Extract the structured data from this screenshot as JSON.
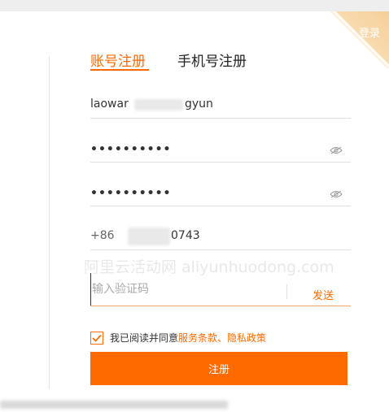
{
  "corner": {
    "login_label": "登录"
  },
  "tabs": [
    {
      "label": "账号注册",
      "active": true
    },
    {
      "label": "手机号注册",
      "active": false
    }
  ],
  "form": {
    "username_left": "laowar",
    "username_right": "gyun",
    "password": "••••••••••",
    "password_confirm": "••••••••••",
    "phone_prefix": "+86",
    "phone_suffix": "0743",
    "code_placeholder": "输入验证码",
    "send_label": "发送"
  },
  "watermark": "阿里云活动网 aliyunhuodong.com",
  "agreement": {
    "prefix": "我已阅读并同意",
    "terms": "服务条款",
    "separator": "、",
    "privacy": "隐私政策",
    "checked": true
  },
  "submit_label": "注册",
  "colors": {
    "accent": "#ff6a00",
    "corner": "#f6cf98"
  }
}
